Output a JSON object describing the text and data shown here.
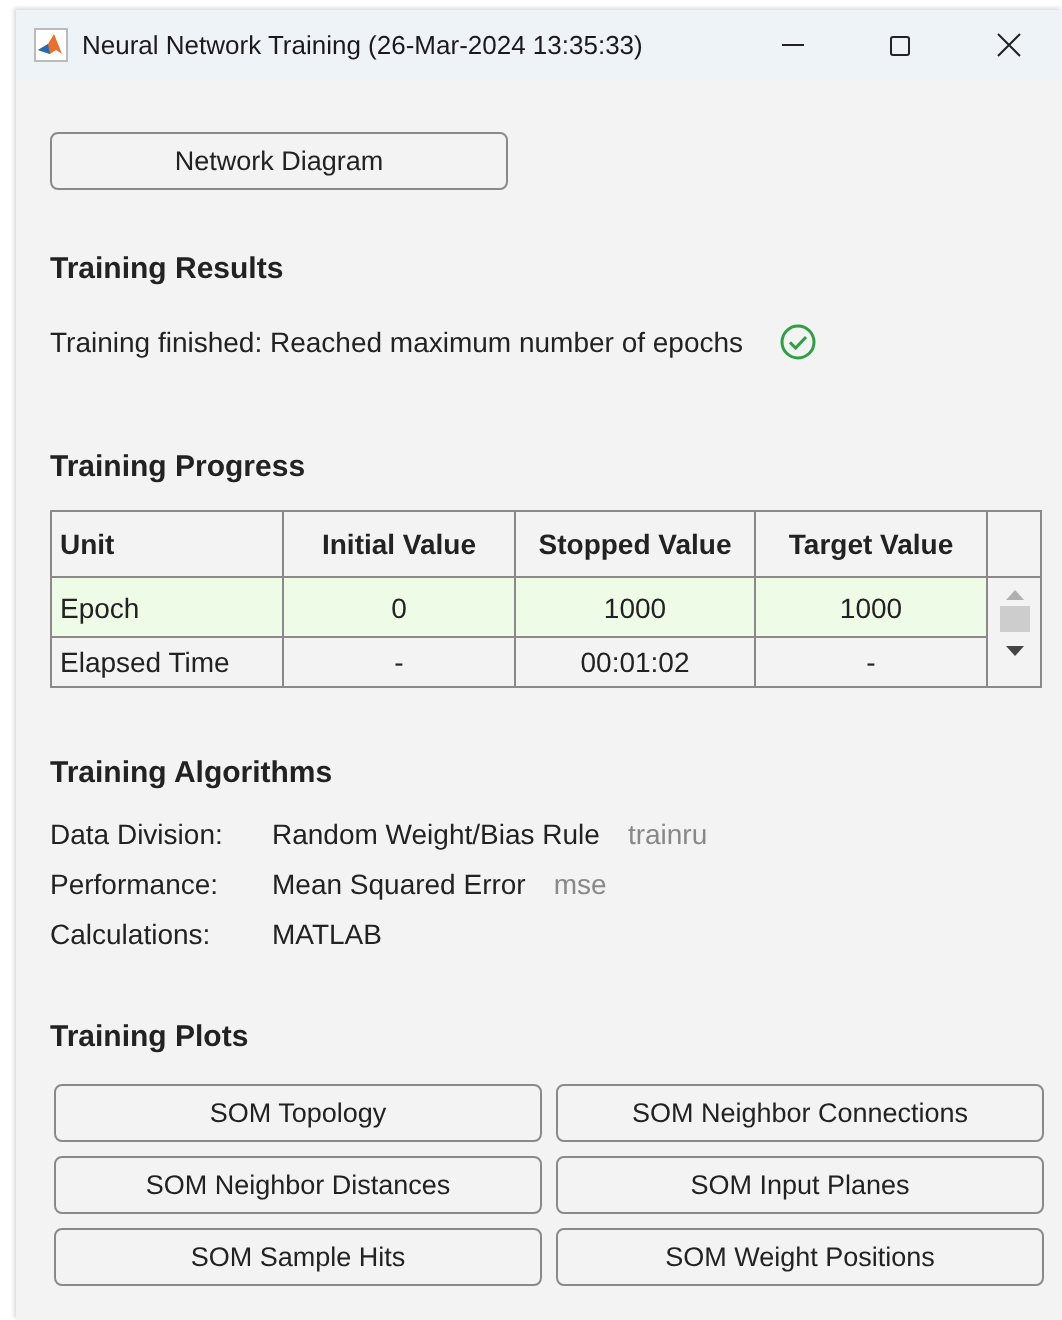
{
  "window": {
    "title": "Neural Network Training (26-Mar-2024 13:35:33)"
  },
  "diagram_button": "Network Diagram",
  "training_results": {
    "heading": "Training Results",
    "message": "Training finished: Reached maximum number of epochs",
    "success": true
  },
  "training_progress": {
    "heading": "Training Progress",
    "columns": [
      "Unit",
      "Initial Value",
      "Stopped Value",
      "Target Value"
    ],
    "rows": [
      {
        "cells": [
          "Epoch",
          "0",
          "1000",
          "1000"
        ],
        "selected": true
      },
      {
        "cells": [
          "Elapsed Time",
          "-",
          "00:01:02",
          "-"
        ],
        "selected": false
      }
    ]
  },
  "training_algorithms": {
    "heading": "Training Algorithms",
    "items": [
      {
        "label": "Data Division:",
        "value": "Random Weight/Bias Rule",
        "code": "trainru"
      },
      {
        "label": "Performance:",
        "value": "Mean Squared Error",
        "code": "mse"
      },
      {
        "label": "Calculations:",
        "value": "MATLAB"
      }
    ]
  },
  "training_plots": {
    "heading": "Training Plots",
    "buttons": [
      "SOM Topology",
      "SOM Neighbor Connections",
      "SOM Neighbor Distances",
      "SOM Input Planes",
      "SOM Sample Hits",
      "SOM Weight Positions"
    ]
  }
}
